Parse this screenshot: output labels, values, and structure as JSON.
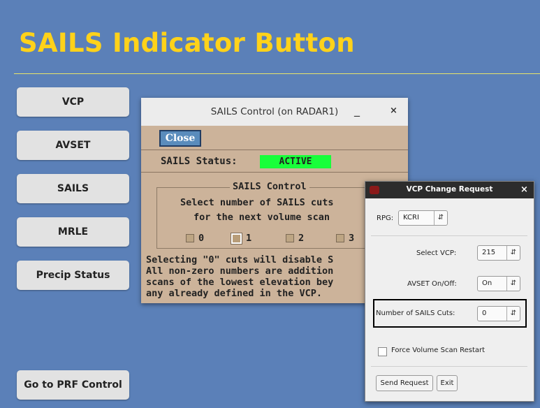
{
  "slide": {
    "title": "SAILS Indicator Button"
  },
  "nav": {
    "vcp": "VCP",
    "avset": "AVSET",
    "sails": "SAILS",
    "mrle": "MRLE",
    "precip": "Precip Status",
    "prf": "Go to PRF Control"
  },
  "sails_control": {
    "title": "SAILS Control (on RADAR1)",
    "minimize_glyph": "_",
    "close_glyph": "×",
    "close_button": "Close",
    "status_label": "SAILS Status:",
    "status_value": "ACTIVE",
    "status_color": "#18ff3a",
    "group_title": "SAILS Control",
    "prompt_line1": "Select number of SAILS cuts",
    "prompt_line2": "for the next volume scan",
    "options": [
      "0",
      "1",
      "2",
      "3"
    ],
    "selected_option": "1",
    "note_line1": "Selecting \"0\" cuts will disable S",
    "note_line2": "All non-zero numbers are addition",
    "note_line3": "scans of the lowest elevation bey",
    "note_line4": "any already defined in the VCP."
  },
  "vcp_change": {
    "title": "VCP Change Request",
    "close_glyph": "×",
    "rpg_label": "RPG:",
    "rpg_value": "KCRI",
    "select_vcp_label": "Select VCP:",
    "select_vcp_value": "215",
    "avset_label": "AVSET On/Off:",
    "avset_value": "On",
    "sails_cuts_label": "Number of SAILS Cuts:",
    "sails_cuts_value": "0",
    "force_restart_label": "Force Volume Scan Restart",
    "force_restart_checked": false,
    "send_button": "Send Request",
    "exit_button": "Exit"
  },
  "colors": {
    "background": "#5b80b8",
    "title": "#ffd21a",
    "sails_panel": "#ccb39a"
  }
}
